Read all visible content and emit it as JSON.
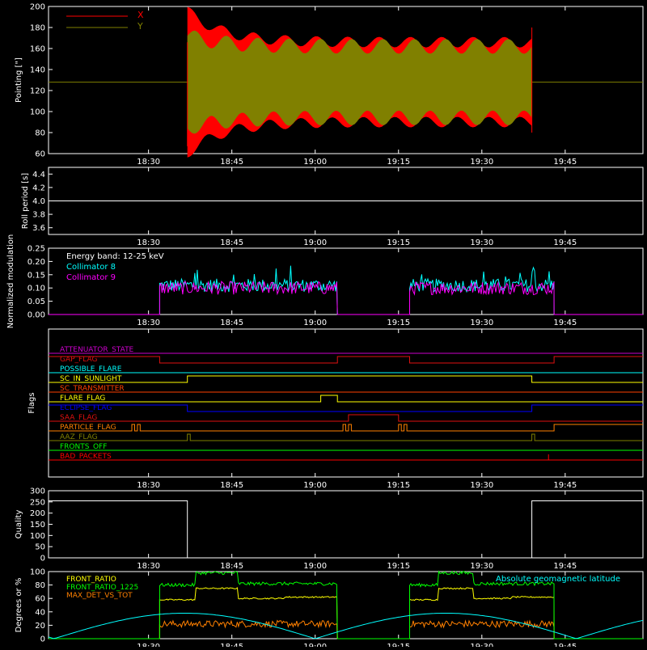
{
  "colors": {
    "axis": "#ffffff",
    "red": "#ff0000",
    "olive": "#808000",
    "cyan": "#00ffff",
    "magenta": "#ff00ff",
    "yellow": "#ffff00",
    "green": "#00ff00",
    "orange": "#ff8000",
    "blue": "#0000ff",
    "dark_red": "#e01010",
    "purple": "#cc00cc"
  },
  "chart_data": [
    {
      "id": "pointing",
      "type": "line",
      "ylabel": "Pointing [\"]",
      "ylim": [
        60,
        200
      ],
      "yticks": [
        60,
        80,
        100,
        120,
        140,
        160,
        180,
        200
      ],
      "x_ticks": [
        "18:30",
        "18:45",
        "19:00",
        "19:15",
        "19:30",
        "19:45"
      ],
      "legend": {
        "placement": "top-left",
        "entries": [
          "X",
          "Y"
        ]
      },
      "series": [
        {
          "name": "X",
          "color": "#ff0000",
          "baseline": 128,
          "active_start": "18:37",
          "active_end": "19:39",
          "range_min": 67,
          "range_max": 178
        },
        {
          "name": "Y",
          "color": "#808000",
          "baseline": 128,
          "active_start": "18:37",
          "active_end": "19:39",
          "range_min": 80,
          "range_max": 184
        }
      ]
    },
    {
      "id": "roll",
      "type": "line",
      "ylabel": "Roll period [s]",
      "ylim": [
        3.5,
        4.5
      ],
      "yticks": [
        "3.6",
        "3.8",
        "4.0",
        "4.2",
        "4.4"
      ],
      "x_ticks": [
        "18:30",
        "18:45",
        "19:00",
        "19:15",
        "19:30",
        "19:45"
      ],
      "series": [
        {
          "value": 4.0
        }
      ]
    },
    {
      "id": "modulation",
      "type": "line",
      "ylabel": "Normalized modulation",
      "ylim": [
        0,
        0.25
      ],
      "yticks": [
        "0.00",
        "0.05",
        "0.10",
        "0.15",
        "0.20",
        "0.25"
      ],
      "x_ticks": [
        "18:30",
        "18:45",
        "19:00",
        "19:15",
        "19:30",
        "19:45"
      ],
      "annotation": "Energy band: 12-25 keV",
      "series": [
        {
          "name": "Collimator 8",
          "color": "#00ffff",
          "level": 0.11
        },
        {
          "name": "Collimator 9",
          "color": "#ff00ff",
          "level": 0.1
        }
      ],
      "active_intervals": [
        [
          "18:32",
          "19:04"
        ],
        [
          "19:17",
          "19:43"
        ]
      ]
    },
    {
      "id": "flags",
      "type": "line",
      "ylabel": "Flags",
      "x_ticks": [
        "18:30",
        "18:45",
        "19:00",
        "19:15",
        "19:30",
        "19:45"
      ],
      "flags": [
        {
          "name": "ATTENUATOR_STATE",
          "color": "#cc00cc"
        },
        {
          "name": "GAP_FLAG",
          "color": "#e01010"
        },
        {
          "name": "POSSIBLE_FLARE",
          "color": "#00ffff"
        },
        {
          "name": "SC_IN_SUNLIGHT",
          "color": "#ffff00"
        },
        {
          "name": "SC_TRANSMITTER",
          "color": "#ff4000"
        },
        {
          "name": "FLARE_FLAG",
          "color": "#ffff00"
        },
        {
          "name": "ECLIPSE_FLAG",
          "color": "#0000ff"
        },
        {
          "name": "SAA_FLAG",
          "color": "#e01010"
        },
        {
          "name": "PARTICLE_FLAG",
          "color": "#ff8000"
        },
        {
          "name": "AAZ_FLAG",
          "color": "#808000"
        },
        {
          "name": "FRONTS_OFF",
          "color": "#00ff00"
        },
        {
          "name": "BAD_PACKETS",
          "color": "#ff0000"
        }
      ]
    },
    {
      "id": "quality",
      "type": "line",
      "ylabel": "Quality",
      "ylim": [
        0,
        300
      ],
      "yticks": [
        "0",
        "50",
        "100",
        "150",
        "200",
        "250",
        "300"
      ],
      "x_ticks": [
        "18:30",
        "18:45",
        "19:00",
        "19:15",
        "19:30",
        "19:45"
      ],
      "series": [
        {
          "high": 255,
          "low": 0,
          "drop_at": "18:37",
          "rise_at": "19:39"
        }
      ]
    },
    {
      "id": "ratios",
      "type": "line",
      "ylabel": "Degrees or %",
      "ylim": [
        0,
        100
      ],
      "yticks": [
        "0",
        "20",
        "40",
        "60",
        "80",
        "100"
      ],
      "x_ticks": [
        "18:30",
        "18:45",
        "19:00",
        "19:15",
        "19:30",
        "19:45"
      ],
      "annotation": "Absolute geomagnetic latitude",
      "series": [
        {
          "name": "FRONT_RATIO",
          "color": "#ffff00",
          "level": 75
        },
        {
          "name": "FRONT_RATIO_1225",
          "color": "#00ff00",
          "level": 82
        },
        {
          "name": "MAX_DET_VS_TOT",
          "color": "#ff8000",
          "level": 22
        },
        {
          "name": "Absolute geomagnetic latitude",
          "color": "#00ffff",
          "level": 38
        }
      ],
      "active_intervals": [
        [
          "18:32",
          "19:04"
        ],
        [
          "19:17",
          "19:43"
        ]
      ]
    }
  ]
}
